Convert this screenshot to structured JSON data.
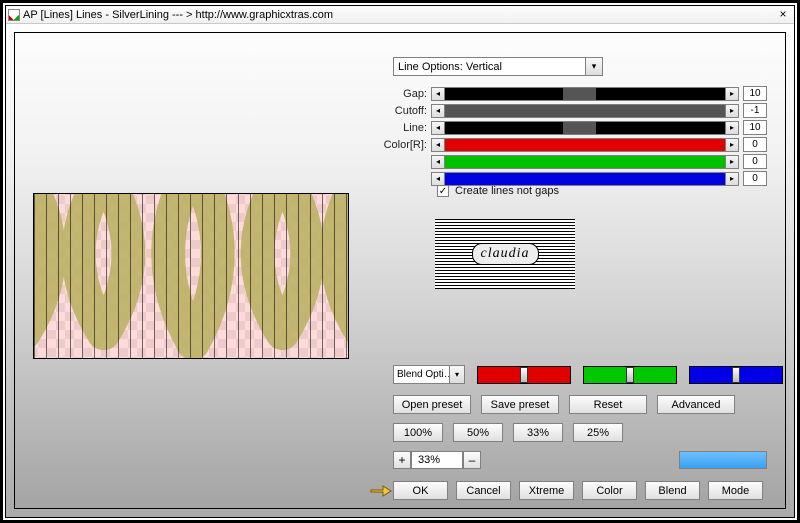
{
  "title": "AP [Lines]  Lines - SilverLining    --- >  http://www.graphicxtras.com",
  "close_label": "×",
  "line_options": {
    "selected": "Line Options: Vertical"
  },
  "sliders": [
    {
      "label": "Gap:",
      "value": "10",
      "bg": "#555",
      "fill_color": "#000",
      "fill_pct": 42,
      "gap": true
    },
    {
      "label": "Cutoff:",
      "value": "-1",
      "bg": "#555",
      "fill_color": "#000",
      "fill_pct": 0,
      "gap": false
    },
    {
      "label": "Line:",
      "value": "10",
      "bg": "#555",
      "fill_color": "#000",
      "fill_pct": 42,
      "gap": true
    },
    {
      "label": "Color[R]:",
      "value": "0",
      "bg": "#555",
      "fill_color": "#e00000",
      "fill_pct": 100,
      "gap": false
    },
    {
      "label": "",
      "value": "0",
      "bg": "#555",
      "fill_color": "#00c000",
      "fill_pct": 100,
      "gap": false
    },
    {
      "label": "",
      "value": "0",
      "bg": "#555",
      "fill_color": "#0000e0",
      "fill_pct": 100,
      "gap": false
    }
  ],
  "checkbox": {
    "checked": "✓",
    "label": "Create lines not gaps"
  },
  "banner_text": "claudia",
  "blend": {
    "label": "Blend Opti…"
  },
  "color_sliders": [
    {
      "bg": "#e00000"
    },
    {
      "bg": "#00c800"
    },
    {
      "bg": "#0000e8"
    }
  ],
  "presets": {
    "open": "Open preset",
    "save": "Save preset",
    "reset": "Reset",
    "advanced": "Advanced"
  },
  "zoom_presets": [
    "100%",
    "50%",
    "33%",
    "25%"
  ],
  "zoom_set": {
    "minus": "–",
    "plus": "+",
    "value": "33%"
  },
  "bottom_buttons": [
    "OK",
    "Cancel",
    "Xtreme",
    "Color",
    "Blend",
    "Mode"
  ]
}
